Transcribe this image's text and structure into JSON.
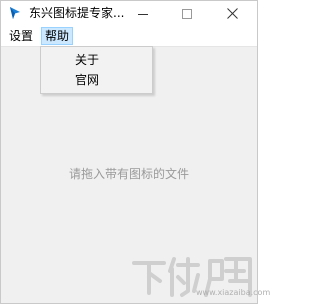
{
  "window": {
    "title": "东兴图标提专家...",
    "controls": {
      "minimize": "minimize-icon",
      "maximize": "maximize-icon",
      "close": "close-icon"
    }
  },
  "menubar": {
    "items": [
      {
        "label": "设置"
      },
      {
        "label": "帮助"
      }
    ]
  },
  "help_menu": {
    "items": [
      {
        "label": "关于"
      },
      {
        "label": "官网"
      }
    ]
  },
  "main": {
    "drop_hint": "请拖入带有图标的文件"
  },
  "watermark": {
    "logo_text": "下载吧",
    "site": "www.xiazaiba.com"
  },
  "colors": {
    "menu_highlight": "#cce8ff",
    "content_bg": "#f0f0f0",
    "hint_text": "#9a9a9a"
  }
}
